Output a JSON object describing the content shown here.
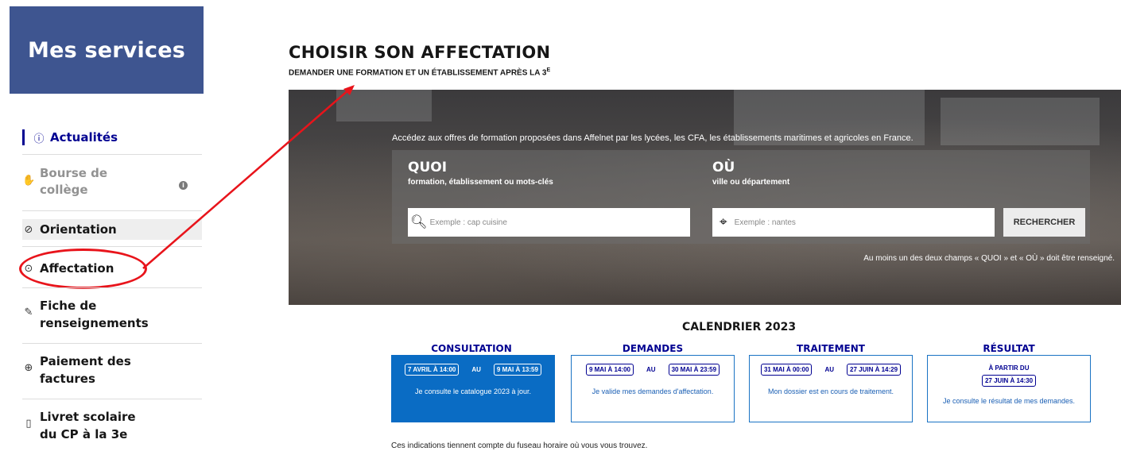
{
  "sidebar": {
    "title": "Mes services",
    "items": [
      {
        "label": "Actualités",
        "icon": "info-circle-icon"
      },
      {
        "label_line1": "Bourse de",
        "label_line2": "collège",
        "icon": "hand-coins-icon",
        "badge": "i"
      },
      {
        "label": "Orientation",
        "icon": "compass-icon"
      },
      {
        "label": "Affectation",
        "icon": "compass-icon"
      },
      {
        "label_line1": "Fiche de",
        "label_line2": "renseignements",
        "icon": "edit-icon"
      },
      {
        "label_line1": "Paiement des",
        "label_line2": "factures",
        "icon": "coins-icon"
      },
      {
        "label_line1": "Livret scolaire",
        "label_line2": "du CP à la 3e",
        "icon": "book-open-icon"
      }
    ]
  },
  "page": {
    "title": "CHOISIR SON AFFECTATION",
    "subtitle": "DEMANDER UNE FORMATION ET UN ÉTABLISSEMENT APRÈS LA 3",
    "subtitle_sup": "E"
  },
  "search": {
    "intro": "Accédez aux offres de formation proposées dans Affelnet par les lycées, les CFA, les établissements maritimes et agricoles en France.",
    "quoi_title": "QUOI",
    "quoi_sub": "formation, établissement ou mots-clés",
    "quoi_placeholder": "Exemple : cap cuisine",
    "ou_title": "OÙ",
    "ou_sub": "ville ou département",
    "ou_placeholder": "Exemple : nantes",
    "button_label": "RECHERCHER",
    "note": "Au moins un des deux champs « QUOI » et « OÙ » doit être renseigné."
  },
  "calendar": {
    "title": "CALENDRIER 2023",
    "phases": [
      {
        "label": "CONSULTATION",
        "start": "7 AVRIL À 14:00",
        "au": "AU",
        "end": "9 MAI À 13:59",
        "desc": "Je consulte le catalogue 2023 à jour."
      },
      {
        "label": "DEMANDES",
        "start": "9 MAI À 14:00",
        "au": "AU",
        "end": "30 MAI À 23:59",
        "desc": "Je valide mes demandes d'affectation."
      },
      {
        "label": "TRAITEMENT",
        "start": "31 MAI À 00:00",
        "au": "AU",
        "end": "27 JUIN À 14:29",
        "desc": "Mon dossier est en cours de traitement."
      },
      {
        "label": "RÉSULTAT",
        "from": "À PARTIR DU",
        "date": "27 JUIN À 14:30",
        "desc": "Je consulte le résultat de mes demandes."
      }
    ],
    "timezone_note": "Ces indications tiennent compte du fuseau horaire où vous vous trouvez."
  },
  "colors": {
    "sidebar_header": "#3e5590",
    "accent_blue": "#000091",
    "current_phase": "#0a6cc4",
    "annotation_red": "#e8141b"
  }
}
